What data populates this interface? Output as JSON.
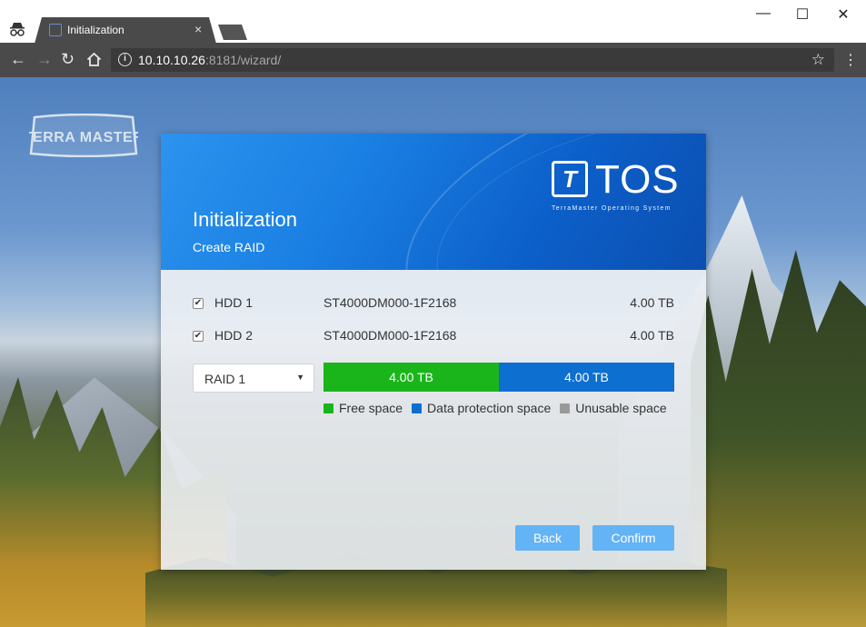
{
  "browser": {
    "tab_title": "Initialization",
    "url_host": "10.10.10.26",
    "url_rest": ":8181/wizard/",
    "window_controls": {
      "minimize": "—",
      "maximize": "☐",
      "close": "✕"
    }
  },
  "brand": {
    "logo_text": "TERRA MASTER"
  },
  "dialog": {
    "title": "Initialization",
    "subtitle": "Create RAID",
    "product_logo": "TOS",
    "product_logo_letter": "T",
    "product_tagline": "TerraMaster Operating System"
  },
  "disks": [
    {
      "checked": true,
      "name": "HDD 1",
      "model": "ST4000DM000-1F2168",
      "size": "4.00 TB"
    },
    {
      "checked": true,
      "name": "HDD 2",
      "model": "ST4000DM000-1F2168",
      "size": "4.00 TB"
    }
  ],
  "raid": {
    "selected": "RAID 1"
  },
  "capacity_bar": {
    "free_label": "4.00 TB",
    "free_fraction": 0.5,
    "protection_label": "4.00 TB",
    "protection_fraction": 0.5
  },
  "legend": {
    "free": "Free space",
    "protection": "Data protection space",
    "unusable": "Unusable space"
  },
  "colors": {
    "free": "#1ab51a",
    "protection": "#0d6fd0",
    "unusable": "#9a9a9a",
    "button": "#63b3f7"
  },
  "buttons": {
    "back": "Back",
    "confirm": "Confirm"
  }
}
